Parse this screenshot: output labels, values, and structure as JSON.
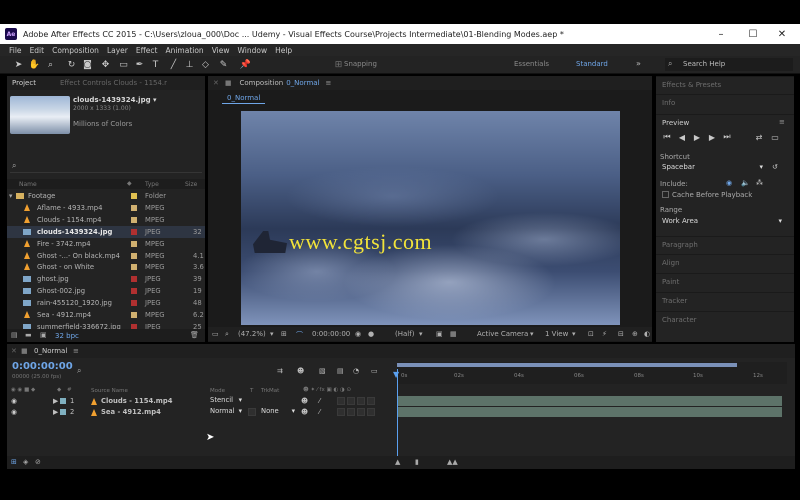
{
  "window": {
    "title": "Adobe After Effects CC 2015 - C:\\Users\\zloua_000\\Doc ... Udemy - Visual Effects Course\\Projects Intermediate\\01-Blending Modes.aep *",
    "logo": "Ae",
    "controls": [
      "–",
      "☐",
      "✕"
    ]
  },
  "menu": [
    "File",
    "Edit",
    "Composition",
    "Layer",
    "Effect",
    "Animation",
    "View",
    "Window",
    "Help"
  ],
  "toolbar": {
    "snapping": "Snapping",
    "workspaces": [
      "Essentials",
      "Standard"
    ],
    "more": "»",
    "search_placeholder": "Search Help"
  },
  "project": {
    "tab": "Project",
    "effect_controls_tab": "Effect Controls Clouds - 1154.r",
    "selected_name": "clouds-1439324.jpg ▾",
    "selected_dims": "2000 x 1333 (1.00)",
    "selected_colors": "Millions of Colors",
    "columns": [
      "Name",
      "Type",
      "Size"
    ],
    "bpc": "32 bpc",
    "items": [
      {
        "name": "Footage",
        "type": "Folder",
        "size": "",
        "color": "#e0c050",
        "kind": "folder"
      },
      {
        "name": "Aflame - 4933.mp4",
        "type": "MPEG",
        "size": "",
        "color": "#d0b070",
        "kind": "cone"
      },
      {
        "name": "Clouds - 1154.mp4",
        "type": "MPEG",
        "size": "",
        "color": "#d0b070",
        "kind": "cone"
      },
      {
        "name": "clouds-1439324.jpg",
        "type": "JPEG",
        "size": "32",
        "color": "#b03030",
        "kind": "image"
      },
      {
        "name": "Fire - 3742.mp4",
        "type": "MPEG",
        "size": "",
        "color": "#d0b070",
        "kind": "cone"
      },
      {
        "name": "Ghost -...- On black.mp4",
        "type": "MPEG",
        "size": "4.1",
        "color": "#d0b070",
        "kind": "cone"
      },
      {
        "name": "Ghost - on White",
        "type": "MPEG",
        "size": "3.6",
        "color": "#d0b070",
        "kind": "cone"
      },
      {
        "name": "ghost.jpg",
        "type": "JPEG",
        "size": "39",
        "color": "#b03030",
        "kind": "image"
      },
      {
        "name": "Ghost-002.jpg",
        "type": "JPEG",
        "size": "19",
        "color": "#b03030",
        "kind": "image"
      },
      {
        "name": "rain-455120_1920.jpg",
        "type": "JPEG",
        "size": "48",
        "color": "#b03030",
        "kind": "image"
      },
      {
        "name": "Sea - 4912.mp4",
        "type": "MPEG",
        "size": "6.2",
        "color": "#d0b070",
        "kind": "cone"
      },
      {
        "name": "summerfield-336672.jpg",
        "type": "JPEG",
        "size": "25",
        "color": "#b03030",
        "kind": "image"
      }
    ]
  },
  "composition": {
    "tab": "Composition",
    "comp_name": "0_Normal",
    "watermark": "www.cgtsj.com",
    "zoom": "(47.2%)",
    "timecode": "0:00:00:00",
    "resolution": "(Half)",
    "camera": "Active Camera",
    "views": "1 View"
  },
  "right_panel": {
    "effects_presets": "Effects & Presets",
    "info": "Info",
    "preview": "Preview",
    "shortcut_label": "Shortcut",
    "shortcut_value": "Spacebar",
    "include_label": "Include:",
    "cache_label": "Cache Before Playback",
    "range_label": "Range",
    "range_value": "Work Area",
    "sections": [
      "Paragraph",
      "Align",
      "Paint",
      "Tracker",
      "Character"
    ]
  },
  "timeline": {
    "comp_name": "0_Normal",
    "timecode": "0:00:00:00",
    "fps": "00000 (25.00 fps)",
    "columns": {
      "source": "Source Name",
      "mode": "Mode",
      "t": "T",
      "trkmat": "TrkMat"
    },
    "ruler": [
      "0s",
      "02s",
      "04s",
      "06s",
      "08s",
      "10s",
      "12s"
    ],
    "layers": [
      {
        "index": "1",
        "name": "Clouds - 1154.mp4",
        "mode": "Stencil",
        "trkmat": ""
      },
      {
        "index": "2",
        "name": "Sea - 4912.mp4",
        "mode": "Normal",
        "trkmat": "None"
      }
    ]
  }
}
